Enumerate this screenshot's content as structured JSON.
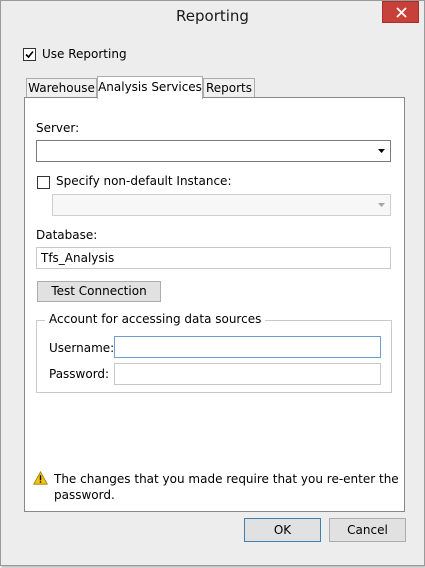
{
  "window": {
    "title": "Reporting"
  },
  "use_reporting": {
    "label": "Use Reporting",
    "checked": true
  },
  "tabs": [
    {
      "label": "Warehouse",
      "active": false
    },
    {
      "label": "Analysis Services",
      "active": true
    },
    {
      "label": "Reports",
      "active": false
    }
  ],
  "server": {
    "label": "Server:",
    "value": ""
  },
  "instance": {
    "label": "Specify non-default Instance:",
    "checked": false,
    "value": ""
  },
  "database": {
    "label": "Database:",
    "value": "Tfs_Analysis"
  },
  "test_connection": {
    "label": "Test Connection"
  },
  "account": {
    "legend": "Account for accessing data sources",
    "username_label": "Username:",
    "username_value": "",
    "password_label": "Password:",
    "password_value": ""
  },
  "warning": {
    "icon": "warning-icon",
    "line1": "The changes that you made require that you re-enter the",
    "line2": "password."
  },
  "buttons": {
    "ok": "OK",
    "cancel": "Cancel"
  },
  "colors": {
    "close_button": "#c7413a",
    "window_bg": "#ededed",
    "focus_border": "#6e9ccf",
    "warning_yellow": "#f2c40f"
  }
}
